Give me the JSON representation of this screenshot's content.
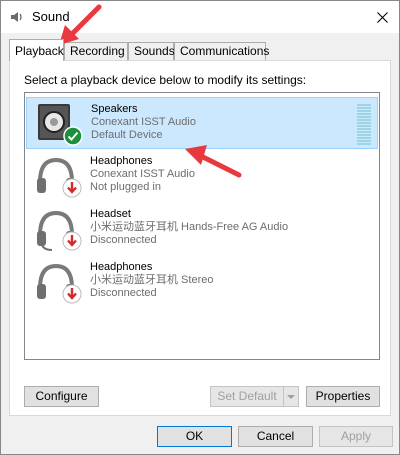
{
  "window": {
    "title": "Sound"
  },
  "tabs": [
    {
      "label": "Playback"
    },
    {
      "label": "Recording"
    },
    {
      "label": "Sounds"
    },
    {
      "label": "Communications"
    }
  ],
  "instruction": "Select a playback device below to modify its settings:",
  "devices": [
    {
      "name": "Speakers",
      "driver": "Conexant ISST Audio",
      "status": "Default Device"
    },
    {
      "name": "Headphones",
      "driver": "Conexant ISST Audio",
      "status": "Not plugged in"
    },
    {
      "name": "Headset",
      "driver": "小米运动蓝牙耳机 Hands-Free AG Audio",
      "status": "Disconnected"
    },
    {
      "name": "Headphones",
      "driver": "小米运动蓝牙耳机 Stereo",
      "status": "Disconnected"
    }
  ],
  "buttons": {
    "configure": "Configure",
    "set_default": "Set Default",
    "properties": "Properties",
    "ok": "OK",
    "cancel": "Cancel",
    "apply": "Apply"
  },
  "colors": {
    "selection": "#cce8ff",
    "annotation_arrow": "#e8393f",
    "default_badge": "#1a8f3c",
    "unplugged_badge": "#d42a2a"
  },
  "icons": {
    "title": "speaker-icon",
    "close": "close-icon",
    "speakers": "speaker-device-icon",
    "headphones": "headphones-icon",
    "headset": "headset-icon",
    "default_badge": "checkmark-icon",
    "unplugged_badge": "down-arrow-icon"
  }
}
